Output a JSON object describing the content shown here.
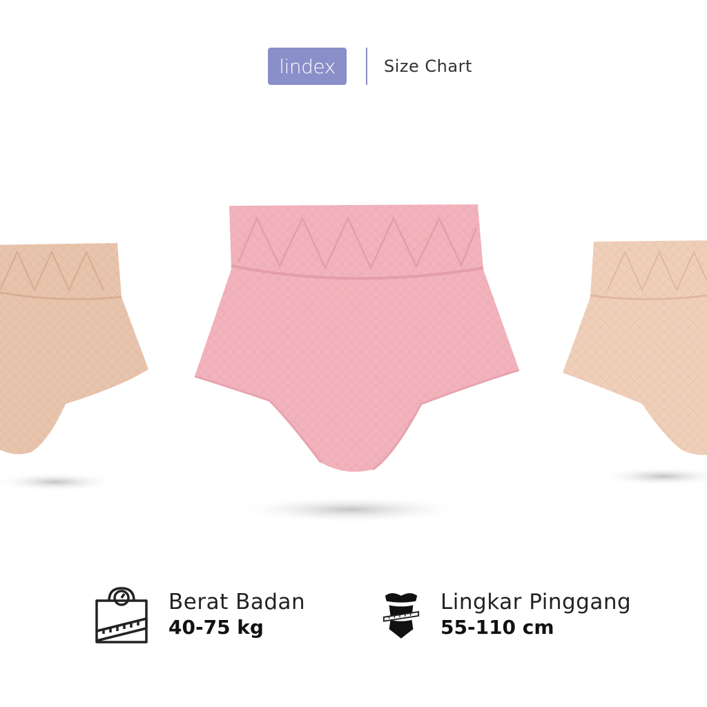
{
  "header": {
    "brand": "lindex",
    "title": "Size Chart"
  },
  "products": {
    "colors": {
      "left": "#e9c4ac",
      "center": "#f3b3bc",
      "right": "#f0cfb9"
    }
  },
  "stats": [
    {
      "icon": "scale-tape-icon",
      "label": "Berat Badan",
      "value": "40-75 kg"
    },
    {
      "icon": "waist-measure-icon",
      "label": "Lingkar Pinggang",
      "value": "55-110 cm"
    }
  ]
}
